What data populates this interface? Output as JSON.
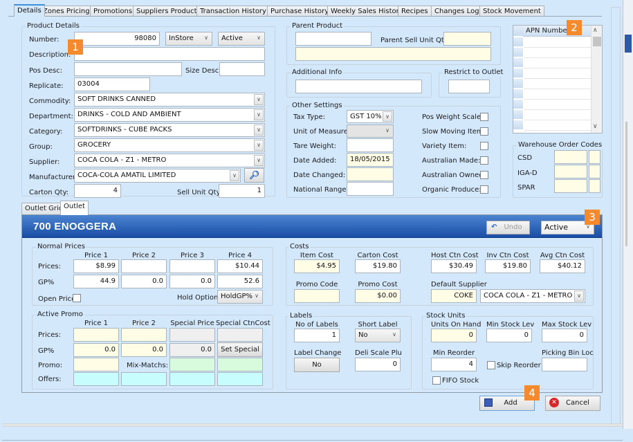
{
  "tabs": [
    {
      "label": "Details",
      "active": true
    },
    {
      "label": "Zones Pricing"
    },
    {
      "label": "Promotions"
    },
    {
      "label": "Suppliers Products"
    },
    {
      "label": "Transaction History"
    },
    {
      "label": "Purchase History"
    },
    {
      "label": "Weekly Sales History"
    },
    {
      "label": "Recipes"
    },
    {
      "label": "Changes Log"
    },
    {
      "label": "Stock Movement"
    }
  ],
  "product_details": {
    "title": "Product Details",
    "number_label": "Number:",
    "number": "98080",
    "store_type": "InStore",
    "status": "Active",
    "description_label": "Description:",
    "description": "",
    "pos_desc_label": "Pos Desc:",
    "pos_desc": "",
    "size_desc_label": "Size Desc:",
    "size_desc": "",
    "replicate_label": "Replicate:",
    "replicate": "03004",
    "commodity_label": "Commodity:",
    "commodity": "SOFT DRINKS CANNED",
    "department_label": "Department:",
    "department": "DRINKS - COLD AND AMBIENT",
    "category_label": "Category:",
    "category": "SOFTDRINKS - CUBE PACKS",
    "group_label": "Group:",
    "group": "GROCERY",
    "supplier_label": "Supplier:",
    "supplier": "COCA COLA - Z1 - METRO",
    "manufacturer_label": "Manufacturer:",
    "manufacturer": "COCA-COLA AMATIL LIMITED",
    "carton_qty_label": "Carton Qty:",
    "carton_qty": "4",
    "sell_unit_qty_label": "Sell Unit Qty:",
    "sell_unit_qty": "1"
  },
  "parent_product": {
    "title": "Parent Product",
    "parent_code": "",
    "parent_sell_unit_qty_label": "Parent Sell Unit Qty:",
    "parent_sell_unit_qty": "",
    "parent_description": ""
  },
  "additional_info": {
    "title": "Additional Info",
    "value": ""
  },
  "restrict_to_outlet": {
    "title": "Restrict to Outlet",
    "value": ""
  },
  "other_settings": {
    "title": "Other Settings",
    "tax_type_label": "Tax Type:",
    "tax_type": "GST 10%",
    "unit_of_measure_label": "Unit of Measure:",
    "unit_of_measure": "",
    "tare_weight_label": "Tare Weight:",
    "tare_weight": "",
    "date_added_label": "Date Added:",
    "date_added": "18/05/2015",
    "date_changed_label": "Date Changed:",
    "date_changed": "",
    "national_range_label": "National Range:",
    "national_range": "",
    "checkboxes": [
      {
        "label": "Pos Weight Scales:",
        "checked": false
      },
      {
        "label": "Slow Moving Item:",
        "checked": false
      },
      {
        "label": "Variety Item:",
        "checked": false
      },
      {
        "label": "Australian Made:",
        "checked": false
      },
      {
        "label": "Australian Owned:",
        "checked": false
      },
      {
        "label": "Organic Produce:",
        "checked": false
      }
    ]
  },
  "apn": {
    "header": "APN Numbers",
    "rows": [
      "",
      "",
      "",
      "",
      "",
      "",
      "",
      "",
      ""
    ]
  },
  "warehouse": {
    "title": "Warehouse Order Codes",
    "rows": [
      {
        "label": "CSD",
        "code": "",
        "extra": ""
      },
      {
        "label": "IGA-D",
        "code": "",
        "extra": ""
      },
      {
        "label": "SPAR",
        "code": "",
        "extra": ""
      }
    ]
  },
  "subtabs": [
    {
      "label": "Outlet Grid"
    },
    {
      "label": "Outlet",
      "active": true
    }
  ],
  "outlet": {
    "title": "700  ENOGGERA",
    "undo_label": "Undo",
    "status": "Active",
    "normal_prices": {
      "title": "Normal Prices",
      "columns": [
        "Price 1",
        "Price 2",
        "Price 3",
        "Price 4"
      ],
      "prices_label": "Prices:",
      "prices": [
        "$8.99",
        "",
        "",
        "$10.44"
      ],
      "gp_label": "GP%",
      "gp": [
        "44.9",
        "0.0",
        "0.0",
        "52.6"
      ],
      "open_price_label": "Open Price",
      "hold_option_label": "Hold Option:",
      "hold_option": "HoldGP%"
    },
    "active_promo": {
      "title": "Active Promo",
      "columns": [
        "Price 1",
        "Price 2",
        "Special Price",
        "Special CtnCost"
      ],
      "prices_label": "Prices:",
      "prices": [
        "",
        "",
        "",
        ""
      ],
      "gp_label": "GP%",
      "gp": [
        "0.0",
        "0.0",
        "0.0"
      ],
      "set_special_label": "Set Special",
      "promo_label": "Promo:",
      "promo": "",
      "mix_matchs_label": "Mix-Matchs:",
      "mix_matchs": [
        "",
        ""
      ],
      "offers_label": "Offers:",
      "offers": [
        "",
        "",
        "",
        ""
      ]
    },
    "costs": {
      "title": "Costs",
      "item_cost_label": "Item Cost",
      "item_cost": "$4.95",
      "carton_cost_label": "Carton Cost",
      "carton_cost": "$19.80",
      "host_ctn_cost_label": "Host Ctn Cost",
      "host_ctn_cost": "$30.49",
      "inv_ctn_cost_label": "Inv Ctn Cost",
      "inv_ctn_cost": "$19.80",
      "avg_ctn_cost_label": "Avg Ctn Cost",
      "avg_ctn_cost": "$40.12",
      "promo_code_label": "Promo Code",
      "promo_code": "",
      "promo_cost_label": "Promo Cost",
      "promo_cost": "$0.00",
      "default_supplier_label": "Default Supplier",
      "default_supplier_code": "COKE",
      "default_supplier": "COCA COLA - Z1 - METRO"
    },
    "labels": {
      "title": "Labels",
      "no_of_labels_label": "No of Labels",
      "no_of_labels": "1",
      "short_label_label": "Short Label",
      "short_label": "No",
      "label_change_label": "Label Change",
      "label_change": "No",
      "deli_scale_plu_label": "Deli Scale Plu",
      "deli_scale_plu": "0"
    },
    "stock_units": {
      "title": "Stock Units",
      "units_on_hand_label": "Units On Hand",
      "units_on_hand": "0",
      "min_stock_lev_label": "Min Stock Lev",
      "min_stock_lev": "0",
      "max_stock_lev_label": "Max Stock Lev",
      "max_stock_lev": "0",
      "min_reorder_label": "Min Reorder",
      "min_reorder": "4",
      "skip_reorder_label": "Skip Reorder",
      "picking_bin_loc_label": "Picking Bin Loc",
      "picking_bin_loc": "",
      "fifo_stock_label": "FIFO Stock"
    }
  },
  "actions": {
    "add_label": "Add",
    "cancel_label": "Cancel"
  },
  "badges": [
    "1",
    "2",
    "3",
    "4"
  ],
  "colors": {
    "badge": "#f48a2c",
    "header_blue": "#1a4ea6",
    "background": "#d4e8fc"
  }
}
